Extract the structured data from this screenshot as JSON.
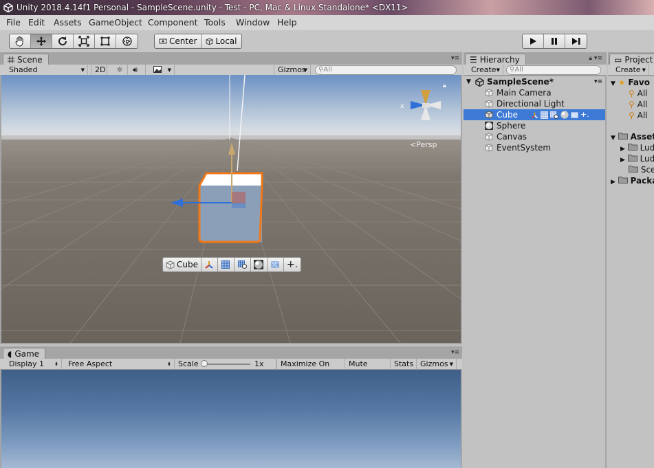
{
  "window": {
    "title": "Unity 2018.4.14f1 Personal - SampleScene.unity - Test - PC, Mac & Linux Standalone* <DX11>"
  },
  "menu": [
    "File",
    "Edit",
    "Assets",
    "GameObject",
    "Component",
    "Tools",
    "Window",
    "Help"
  ],
  "toolbar": {
    "pivot_label": "Center",
    "space_label": "Local"
  },
  "scene": {
    "tab_label": "Scene",
    "shading": "Shaded",
    "mode_2d": "2D",
    "gizmos": "Gizmos",
    "search_placeholder": "All",
    "persp_label": "Persp",
    "axis_y": "y",
    "axis_x": "x",
    "overlay_object": "Cube"
  },
  "game": {
    "tab_label": "Game",
    "display": "Display 1",
    "aspect": "Free Aspect",
    "scale_label": "Scale",
    "scale_value": "1x",
    "maximize": "Maximize On Play",
    "mute": "Mute Audio",
    "stats": "Stats",
    "gizmos": "Gizmos"
  },
  "hierarchy": {
    "tab_label": "Hierarchy",
    "create": "Create",
    "search_placeholder": "All",
    "scene_name": "SampleScene*",
    "items": [
      "Main Camera",
      "Directional Light",
      "Cube",
      "Sphere",
      "Canvas",
      "EventSystem"
    ],
    "selected_index": 2
  },
  "project": {
    "tab_label": "Project",
    "create": "Create",
    "favorites_label": "Favo",
    "favorites": [
      "All",
      "All",
      "All"
    ],
    "assets_label": "Asset",
    "assets": [
      "Lud",
      "Lud",
      "Sce"
    ],
    "packages_label": "Packa"
  },
  "colors": {
    "selection": "#3d7ad6",
    "outline": "#f07818"
  }
}
